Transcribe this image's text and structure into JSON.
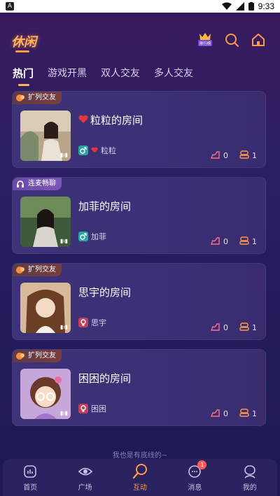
{
  "status_bar": {
    "left_icon": "A",
    "time": "9:33"
  },
  "header": {
    "logo": "休闲",
    "ranking_label": "排行榜"
  },
  "tabs": [
    "热门",
    "游戏开黑",
    "双人交友",
    "多人交友"
  ],
  "rooms": [
    {
      "tag": "扩列交友",
      "tag_style": "orange",
      "title": "粒粒的房间",
      "title_heart": true,
      "owner": "粒粒",
      "owner_heart": true,
      "gender": "male",
      "likes": "0",
      "seats": "1",
      "thumb": "rose"
    },
    {
      "tag": "连麦畅聊",
      "tag_style": "purple",
      "title": "加菲的房间",
      "title_heart": false,
      "owner": "加菲",
      "owner_heart": false,
      "gender": "male",
      "likes": "0",
      "seats": "1",
      "thumb": "green"
    },
    {
      "tag": "扩列交友",
      "tag_style": "orange",
      "title": "思宇的房间",
      "title_heart": false,
      "owner": "思宇",
      "owner_heart": false,
      "gender": "female",
      "likes": "0",
      "seats": "1",
      "thumb": "tan"
    },
    {
      "tag": "扩列交友",
      "tag_style": "orange",
      "title": "困困的房间",
      "title_heart": false,
      "owner": "困困",
      "owner_heart": false,
      "gender": "female",
      "likes": "0",
      "seats": "1",
      "thumb": "cartoon"
    }
  ],
  "footer_note": "我也是有底线的~",
  "nav": [
    {
      "label": "首页",
      "icon": "home-icon"
    },
    {
      "label": "广场",
      "icon": "eye-icon"
    },
    {
      "label": "互动",
      "icon": "interact-icon",
      "active": true
    },
    {
      "label": "消息",
      "icon": "message-icon",
      "badge": "1"
    },
    {
      "label": "我的",
      "icon": "profile-icon"
    }
  ],
  "colors": {
    "accent": "#ff9a4a",
    "male": "#2aa7a0",
    "female": "#c2415a"
  }
}
